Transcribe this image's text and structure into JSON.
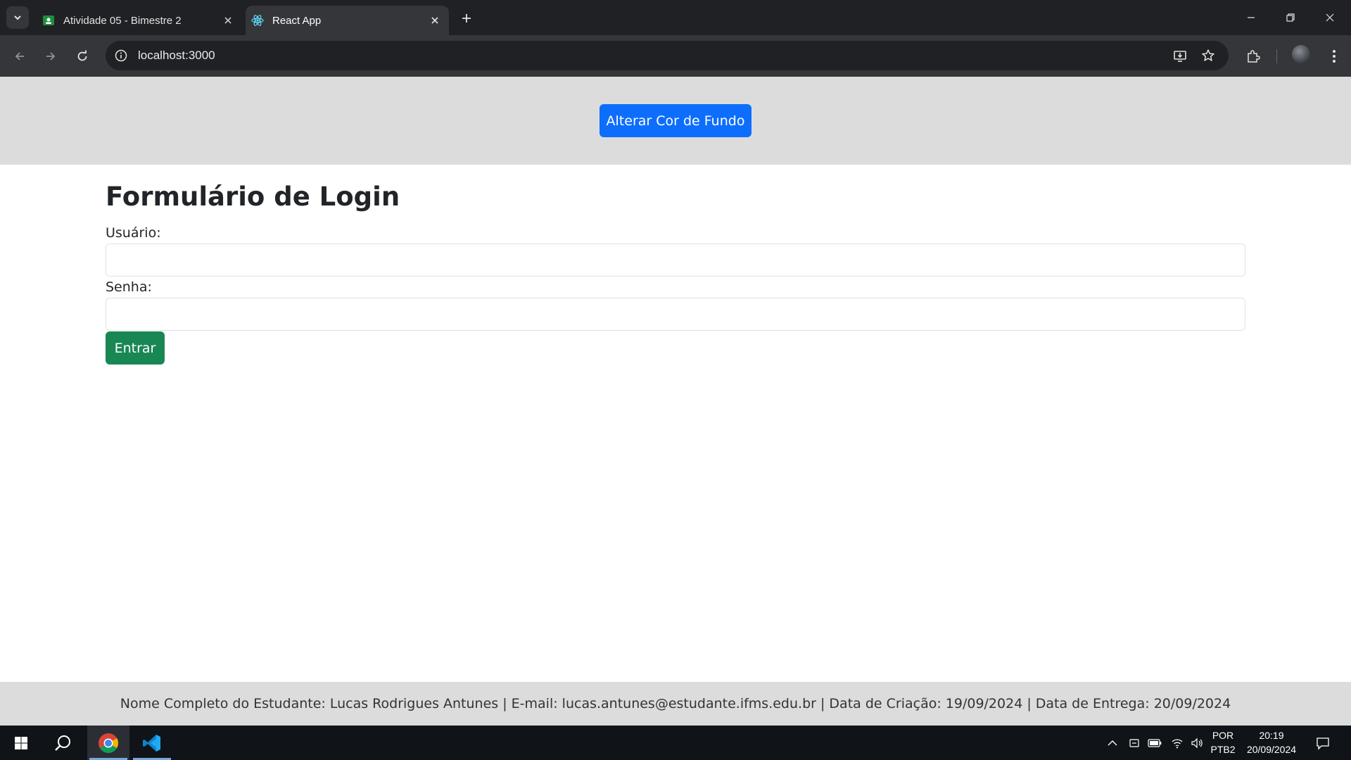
{
  "browser": {
    "tabs": [
      {
        "title": "Atividade 05 - Bimestre 2",
        "active": false,
        "icon": "classroom-icon"
      },
      {
        "title": "React App",
        "active": true,
        "icon": "react-icon"
      }
    ],
    "address": "localhost:3000"
  },
  "page": {
    "header_button": "Alterar Cor de Fundo",
    "form_title": "Formulário de Login",
    "user_label": "Usuário:",
    "user_value": "",
    "password_label": "Senha:",
    "password_value": "",
    "submit_label": "Entrar",
    "footer_text": "Nome Completo do Estudante: Lucas Rodrigues Antunes | E-mail: lucas.antunes@estudante.ifms.edu.br | Data de Criação: 19/09/2024 | Data de Entrega: 20/09/2024"
  },
  "taskbar": {
    "apps": [
      "windows-start",
      "search",
      "chrome",
      "vscode"
    ],
    "language_top": "POR",
    "language_bottom": "PTB2",
    "time": "20:19",
    "date": "20/09/2024"
  },
  "colors": {
    "primary": "#0d6efd",
    "success": "#198754",
    "header_bg": "#dcdcdc",
    "chrome_dark": "#202124"
  }
}
